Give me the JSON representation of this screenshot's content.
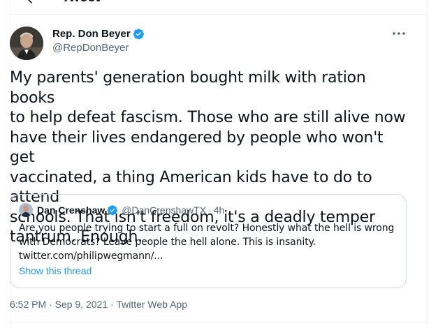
{
  "header": {
    "title": "Tweet"
  },
  "author": {
    "name": "Rep. Don Beyer",
    "handle": "@RepDonBeyer",
    "verified_icon": "verified-badge-icon",
    "more_icon": "more-icon"
  },
  "tweet": {
    "lines": [
      "My parents' generation bought milk with ration books",
      "to help defeat fascism. Those who are still alive now",
      "have their lives endangered by people who won't get",
      "vaccinated, a thing American kids have to do to attend",
      "schools. That isn't freedom, it's a deadly temper",
      "tantrum. Enough."
    ]
  },
  "quote": {
    "name": "Dan Crenshaw",
    "handle": "@DanCrenshawTX",
    "sep": "·",
    "time": "4h",
    "lines": [
      "Are you people trying to start a full on revolt? Honestly what the hell is wrong",
      "with Democrats? Leave people the hell alone. This is insanity.",
      "twitter.com/philipwegmann/..."
    ],
    "show_thread": "Show this thread"
  },
  "meta": {
    "time": "6:52 PM",
    "sep1": " · ",
    "date": "Sep 9, 2021",
    "sep2": " · ",
    "source": "Twitter Web App"
  },
  "colors": {
    "accent": "#1d9bf0",
    "text": "#0f1419",
    "muted": "#536471",
    "border": "#cfd9de"
  }
}
